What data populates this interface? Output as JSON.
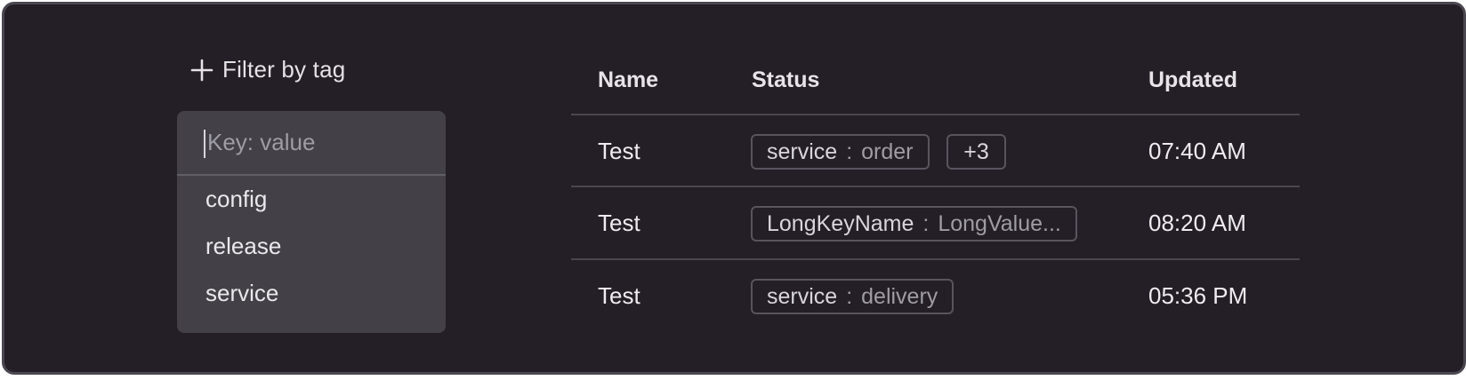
{
  "filter": {
    "button_label": "Filter by tag",
    "icon": "plus-icon",
    "input_placeholder": "Key: value",
    "options": [
      "config",
      "release",
      "service"
    ]
  },
  "table": {
    "headers": [
      "Name",
      "Status",
      "Updated"
    ],
    "rows": [
      {
        "name": "Test",
        "tag_key": "service",
        "tag_sep": ":",
        "tag_value": "order",
        "extra": "+3",
        "updated": "07:40 AM"
      },
      {
        "name": "Test",
        "tag_key": "LongKeyName",
        "tag_sep": ":",
        "tag_value": "LongValue...",
        "updated": "08:20 AM"
      },
      {
        "name": "Test",
        "tag_key": "service",
        "tag_sep": ":",
        "tag_value": "delivery",
        "updated": "05:36 PM"
      }
    ]
  },
  "colors": {
    "background": "#241e26",
    "frame_border": "#4b4750",
    "dropdown_bg": "#434147",
    "divider": "#4a4650",
    "tag_border": "#58545e",
    "muted_text": "#9e9ca4",
    "text": "#eeecf0"
  }
}
